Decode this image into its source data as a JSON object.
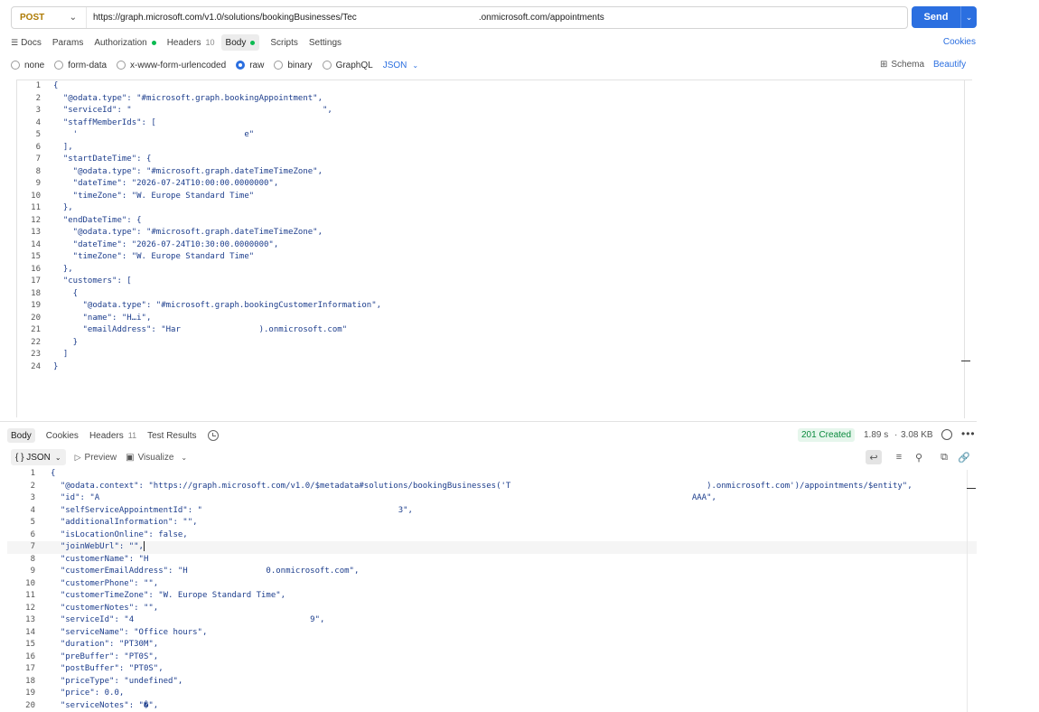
{
  "request": {
    "method": "POST",
    "url_start": "https://graph.microsoft.com/v1.0/solutions/bookingBusinesses/Tec",
    "url_end": ".onmicrosoft.com/appointments",
    "send_label": "Send"
  },
  "req_tabs": {
    "docs": "Docs",
    "params": "Params",
    "authorization": "Authorization",
    "headers": "Headers",
    "headers_count": "10",
    "body": "Body",
    "scripts": "Scripts",
    "settings": "Settings",
    "cookies": "Cookies"
  },
  "body_types": {
    "none": "none",
    "form_data": "form-data",
    "urlencoded": "x-www-form-urlencoded",
    "raw": "raw",
    "binary": "binary",
    "graphql": "GraphQL",
    "format": "JSON",
    "schema": "Schema",
    "beautify": "Beautify"
  },
  "request_body": [
    {
      "n": "1",
      "t": "{"
    },
    {
      "n": "2",
      "t": "  \"@odata.type\": \"#microsoft.graph.bookingAppointment\","
    },
    {
      "n": "3",
      "t": "  \"serviceId\": \"                                       \","
    },
    {
      "n": "4",
      "t": "  \"staffMemberIds\": ["
    },
    {
      "n": "5",
      "t": "    '                                  e\""
    },
    {
      "n": "6",
      "t": "  ],"
    },
    {
      "n": "7",
      "t": "  \"startDateTime\": {"
    },
    {
      "n": "8",
      "t": "    \"@odata.type\": \"#microsoft.graph.dateTimeTimeZone\","
    },
    {
      "n": "9",
      "t": "    \"dateTime\": \"2026-07-24T10:00:00.0000000\","
    },
    {
      "n": "10",
      "t": "    \"timeZone\": \"W. Europe Standard Time\""
    },
    {
      "n": "11",
      "t": "  },"
    },
    {
      "n": "12",
      "t": "  \"endDateTime\": {"
    },
    {
      "n": "13",
      "t": "    \"@odata.type\": \"#microsoft.graph.dateTimeTimeZone\","
    },
    {
      "n": "14",
      "t": "    \"dateTime\": \"2026-07-24T10:30:00.0000000\","
    },
    {
      "n": "15",
      "t": "    \"timeZone\": \"W. Europe Standard Time\""
    },
    {
      "n": "16",
      "t": "  },"
    },
    {
      "n": "17",
      "t": "  \"customers\": ["
    },
    {
      "n": "18",
      "t": "    {"
    },
    {
      "n": "19",
      "t": "      \"@odata.type\": \"#microsoft.graph.bookingCustomerInformation\","
    },
    {
      "n": "20",
      "t": "      \"name\": \"H…i\","
    },
    {
      "n": "21",
      "t": "      \"emailAddress\": \"Har                ).onmicrosoft.com\""
    },
    {
      "n": "22",
      "t": "    }"
    },
    {
      "n": "23",
      "t": "  ]"
    },
    {
      "n": "24",
      "t": "}"
    }
  ],
  "resp_tabs": {
    "body": "Body",
    "cookies": "Cookies",
    "headers": "Headers",
    "headers_count": "11",
    "test_results": "Test Results",
    "status": "201 Created",
    "time": "1.89 s",
    "size": "3.08 KB",
    "more": "•••"
  },
  "view_bar": {
    "format": "{ } JSON",
    "preview": "Preview",
    "visualize": "Visualize"
  },
  "response_body": [
    {
      "n": "1",
      "t": "{"
    },
    {
      "n": "2",
      "t": "  \"@odata.context\": \"https://graph.microsoft.com/v1.0/$metadata#solutions/bookingBusinesses('T                                        ).onmicrosoft.com')/appointments/$entity\","
    },
    {
      "n": "3",
      "t": "  \"id\": \"A                                                                                                                         AAA\","
    },
    {
      "n": "4",
      "t": "  \"selfServiceAppointmentId\": \"                                        3\","
    },
    {
      "n": "5",
      "t": "  \"additionalInformation\": \"\","
    },
    {
      "n": "6",
      "t": "  \"isLocationOnline\": false,"
    },
    {
      "n": "7",
      "t": "  \"joinWebUrl\": \"\","
    },
    {
      "n": "8",
      "t": "  \"customerName\": \"H"
    },
    {
      "n": "9",
      "t": "  \"customerEmailAddress\": \"H                0.onmicrosoft.com\","
    },
    {
      "n": "10",
      "t": "  \"customerPhone\": \"\","
    },
    {
      "n": "11",
      "t": "  \"customerTimeZone\": \"W. Europe Standard Time\","
    },
    {
      "n": "12",
      "t": "  \"customerNotes\": \"\","
    },
    {
      "n": "13",
      "t": "  \"serviceId\": \"4                                    9\","
    },
    {
      "n": "14",
      "t": "  \"serviceName\": \"Office hours\","
    },
    {
      "n": "15",
      "t": "  \"duration\": \"PT30M\","
    },
    {
      "n": "16",
      "t": "  \"preBuffer\": \"PT0S\","
    },
    {
      "n": "17",
      "t": "  \"postBuffer\": \"PT0S\","
    },
    {
      "n": "18",
      "t": "  \"priceType\": \"undefined\","
    },
    {
      "n": "19",
      "t": "  \"price\": 0.0,"
    },
    {
      "n": "20",
      "t": "  \"serviceNotes\": \"�\","
    }
  ],
  "colors": {
    "accent": "#2b6fe0",
    "method": "#ad7a03",
    "status_ok": "#0a8a3d",
    "dot": "#0cbb52"
  }
}
